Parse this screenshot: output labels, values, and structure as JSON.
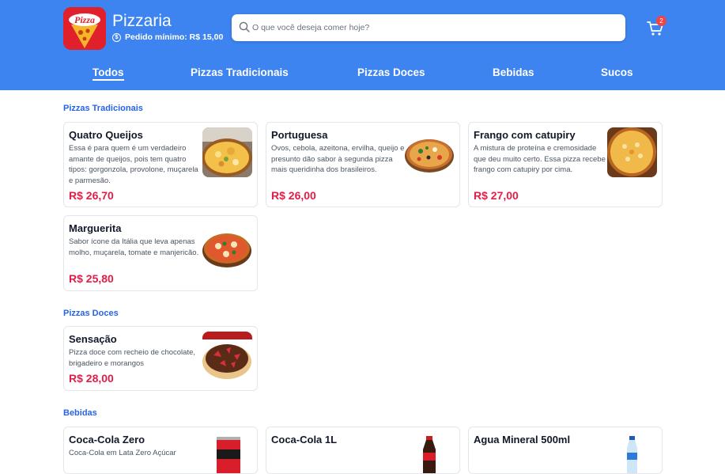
{
  "store": {
    "name": "Pizzaria",
    "min_order": "Pedido mínimo: R$ 15,00",
    "logo_text": "Pizza"
  },
  "search": {
    "placeholder": "O que você deseja comer hoje?"
  },
  "cart": {
    "count": "2"
  },
  "tabs": [
    {
      "label": "Todos",
      "active": true
    },
    {
      "label": "Pizzas Tradicionais"
    },
    {
      "label": "Pizzas Doces"
    },
    {
      "label": "Bebidas"
    },
    {
      "label": "Sucos"
    }
  ],
  "sections": [
    {
      "title": "Pizzas Tradicionais",
      "items": [
        {
          "name": "Quatro Queijos",
          "description": "Essa é para quem é um verdadeiro amante de queijos, pois tem quatro tipos: gorgonzola, provolone, muçarela e parmesão.",
          "price": "R$ 26,70",
          "image": "pizza-quatro-queijos"
        },
        {
          "name": "Portuguesa",
          "description": "Ovos, cebola, azeitona, ervilha, queijo e presunto dão sabor à segunda pizza mais queridinha dos brasileiros.",
          "price": "R$ 26,00",
          "image": "pizza-portuguesa"
        },
        {
          "name": "Frango com catupiry",
          "description": "A mistura de proteína e cremosidade que deu muito certo. Essa pizza recebe frango com catupiry por cima.",
          "price": "R$ 27,00",
          "image": "pizza-frango"
        },
        {
          "name": "Marguerita",
          "description": "Sabor ícone da Itália que leva apenas molho, muçarela, tomate e manjericão.",
          "price": "R$ 25,80",
          "image": "pizza-marguerita"
        }
      ]
    },
    {
      "title": "Pizzas Doces",
      "items": [
        {
          "name": "Sensação",
          "description": "Pizza doce com recheio de chocolate, brigadeiro e morangos",
          "price": "R$ 28,00",
          "image": "pizza-sensacao"
        }
      ]
    },
    {
      "title": "Bebidas",
      "items": [
        {
          "name": "Coca-Cola Zero",
          "description": "Coca-Cola em Lata Zero Açúcar",
          "price": "",
          "image": "coca-zero-can"
        },
        {
          "name": "Coca-Cola 1L",
          "description": "",
          "price": "",
          "image": "coca-bottle"
        },
        {
          "name": "Agua Mineral 500ml",
          "description": "",
          "price": "",
          "image": "water-bottle"
        }
      ]
    }
  ],
  "colors": {
    "header": "#3d84f0",
    "accent": "#2563eb",
    "price": "#e11d48",
    "badge": "#ef4444"
  }
}
